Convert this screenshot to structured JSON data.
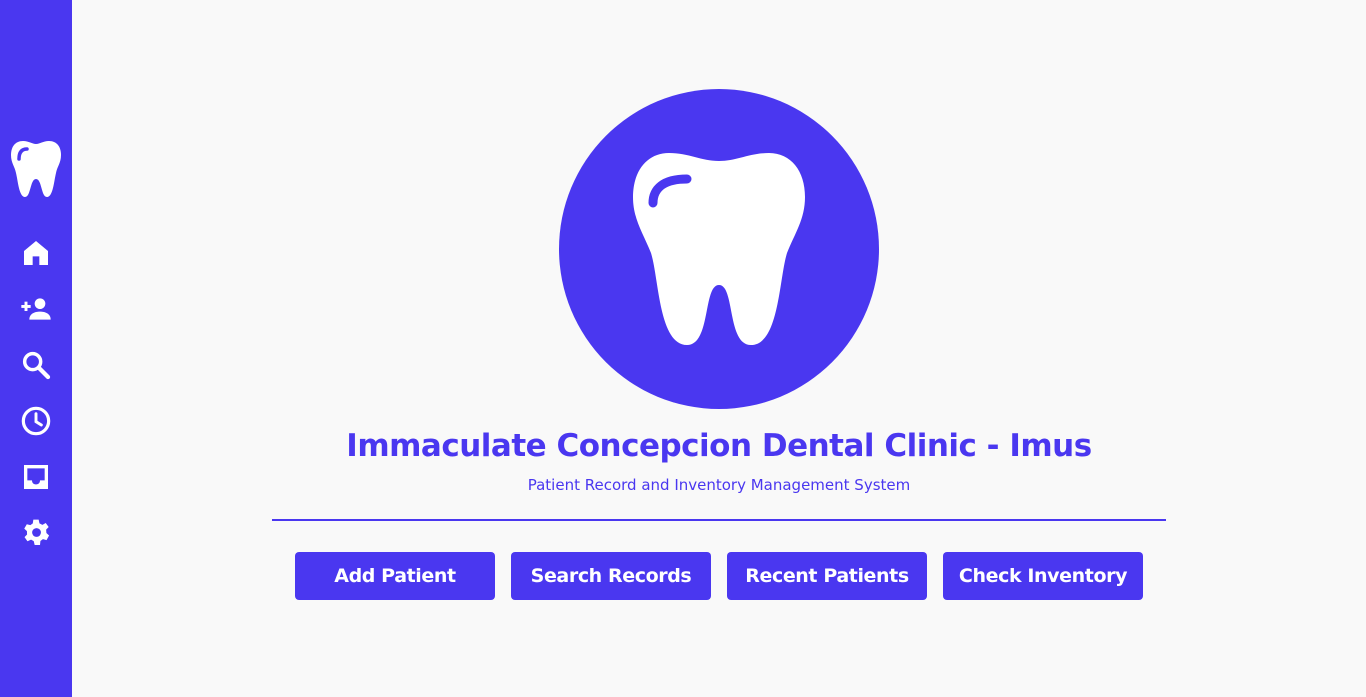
{
  "colors": {
    "accent": "#4a37f0",
    "background": "#f9f9f9",
    "button_text": "#ffffff"
  },
  "sidebar": {
    "logo_icon": "tooth-icon",
    "items": [
      {
        "icon": "home-icon"
      },
      {
        "icon": "person-add-icon"
      },
      {
        "icon": "search-icon"
      },
      {
        "icon": "clock-icon"
      },
      {
        "icon": "inbox-icon"
      },
      {
        "icon": "gear-icon"
      }
    ]
  },
  "hero": {
    "icon": "tooth-icon",
    "title": "Immaculate Concepcion Dental Clinic - Imus",
    "subtitle": "Patient Record and Inventory Management System"
  },
  "actions": {
    "add_patient": "Add Patient",
    "search_records": "Search Records",
    "recent_patients": "Recent Patients",
    "check_inventory": "Check Inventory"
  }
}
